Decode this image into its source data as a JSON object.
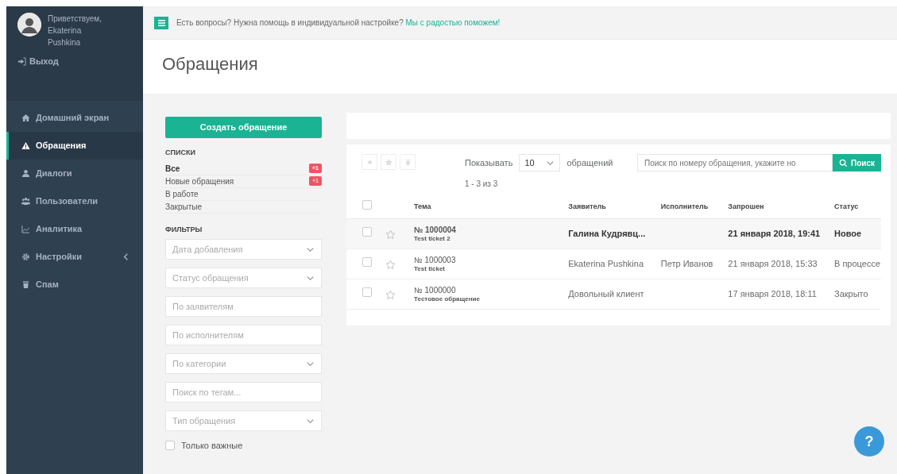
{
  "sidebar": {
    "greeting": "Приветствуем,",
    "user_name": "Ekaterina Pushkina",
    "logout": "Выход",
    "items": [
      {
        "label": "Домашний экран",
        "selected": false,
        "kind": "link"
      },
      {
        "label": "Обращения",
        "selected": true,
        "kind": "link"
      },
      {
        "label": "Диалоги",
        "selected": false,
        "kind": "link"
      },
      {
        "label": "Пользователи",
        "selected": false,
        "kind": "link"
      },
      {
        "label": "Аналитика",
        "selected": false,
        "kind": "link"
      },
      {
        "label": "Настройки",
        "selected": false,
        "kind": "submenu"
      },
      {
        "label": "Спам",
        "selected": false,
        "kind": "link"
      }
    ]
  },
  "topbar": {
    "text": "Есть вопросы? Нужна помощь в индивидуальной настройке?",
    "link": "Мы с радостью поможем!"
  },
  "page_title": "Обращения",
  "create_button": "Создать обращение",
  "lists": {
    "title": "СПИСКИ",
    "items": [
      {
        "label": "Все",
        "selected": true,
        "badge": "+1"
      },
      {
        "label": "Новые обращения",
        "selected": false,
        "badge": "+1"
      },
      {
        "label": "В работе",
        "selected": false
      },
      {
        "label": "Закрытые",
        "selected": false
      }
    ]
  },
  "filters": {
    "title": "ФИЛЬТРЫ",
    "items": [
      {
        "kind": "select",
        "placeholder": "Дата добавления"
      },
      {
        "kind": "select",
        "placeholder": "Статус обращения"
      },
      {
        "kind": "input",
        "placeholder": "По заявителям"
      },
      {
        "kind": "input",
        "placeholder": "По исполнителям"
      },
      {
        "kind": "select",
        "placeholder": "По категории"
      },
      {
        "kind": "input",
        "placeholder": "Поиск по тегам..."
      },
      {
        "kind": "select",
        "placeholder": "Тип обращения"
      },
      {
        "kind": "checkbox",
        "label": "Только важные",
        "checked": false
      }
    ]
  },
  "toolbar": {
    "show_label": "Показывать",
    "page_size": "10",
    "unit": "обращений",
    "range": "1 - 3 из 3",
    "search_placeholder": "Поиск по номеру обращения, укажите но",
    "search_button": "Поиск"
  },
  "table": {
    "select_all_checked": false,
    "columns": [
      "Тема",
      "Заявитель",
      "Исполнитель",
      "Запрошен",
      "Статус"
    ],
    "rows": [
      {
        "number": "№ 1000004",
        "subject": "Test ticket 2",
        "requester": "Галина Кудрявц...",
        "requested": "21 января 2018, 19:41",
        "status": "Новое",
        "unread": true,
        "checked": false,
        "starred": false
      },
      {
        "number": "№ 1000003",
        "subject": "Test ticket",
        "requester": "Ekaterina Pushkina",
        "assignee": "Петр Иванов",
        "requested": "21 января 2018, 15:33",
        "status": "В процессе",
        "unread": false,
        "checked": false,
        "starred": false
      },
      {
        "number": "№ 1000000",
        "subject": "Тестовое обращение",
        "requester": "Довольный клиент",
        "requested": "17 января 2018, 18:11",
        "status": "Закрыто",
        "unread": false,
        "checked": false,
        "starred": false
      }
    ]
  },
  "help_button": "?"
}
